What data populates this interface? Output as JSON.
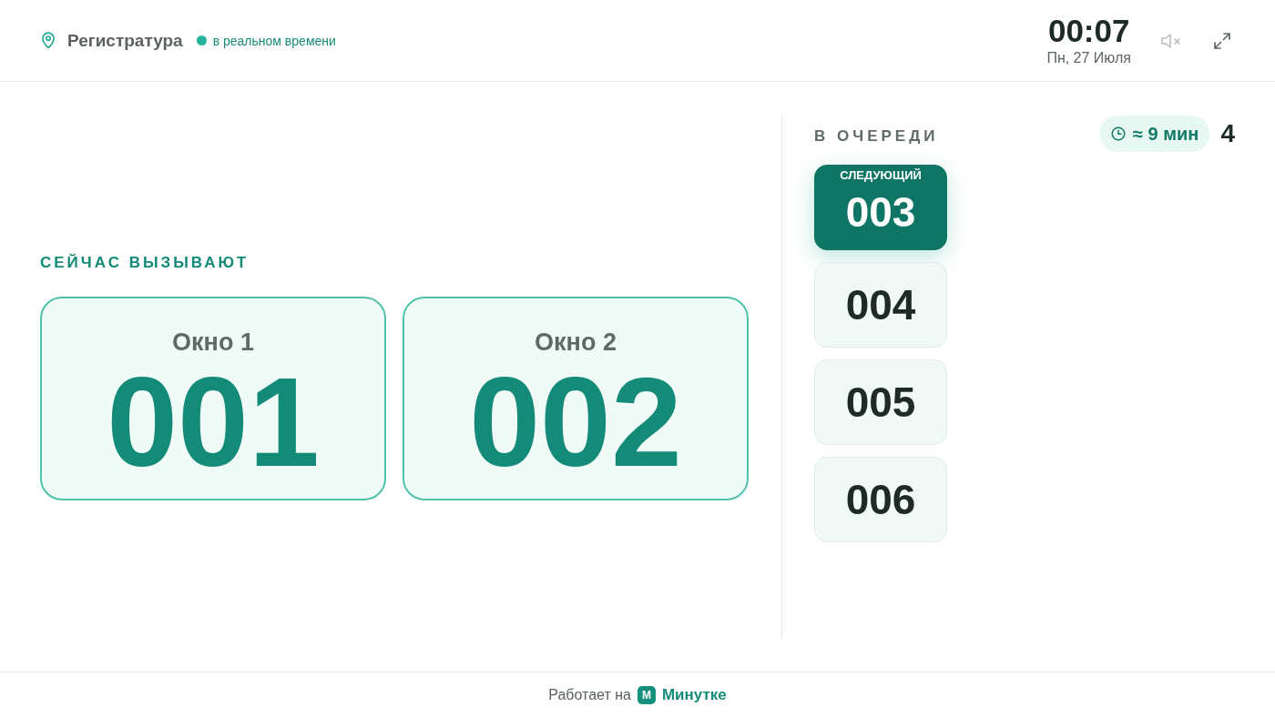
{
  "header": {
    "location": "Регистратура",
    "live": true,
    "live_label": "в реальном времени",
    "time": "00:07",
    "date": "Пн, 27 Июля",
    "muted": true
  },
  "now_calling": {
    "title": "СЕЙЧАС ВЫЗЫВАЮТ",
    "windows": [
      {
        "label": "Окно 1",
        "ticket": "001"
      },
      {
        "label": "Окно 2",
        "ticket": "002"
      }
    ]
  },
  "queue": {
    "title": "В ОЧЕРЕДИ",
    "wait_estimate": "≈ 9 мин",
    "count": "4",
    "tickets": [
      {
        "number": "003",
        "selected": true,
        "tag": "СЛЕДУЮЩИЙ"
      },
      {
        "number": "004",
        "selected": false
      },
      {
        "number": "005",
        "selected": false
      },
      {
        "number": "006",
        "selected": false
      }
    ]
  },
  "footer": {
    "prefix": "Работает на",
    "logo_letter": "М",
    "brand": "Минутке"
  }
}
